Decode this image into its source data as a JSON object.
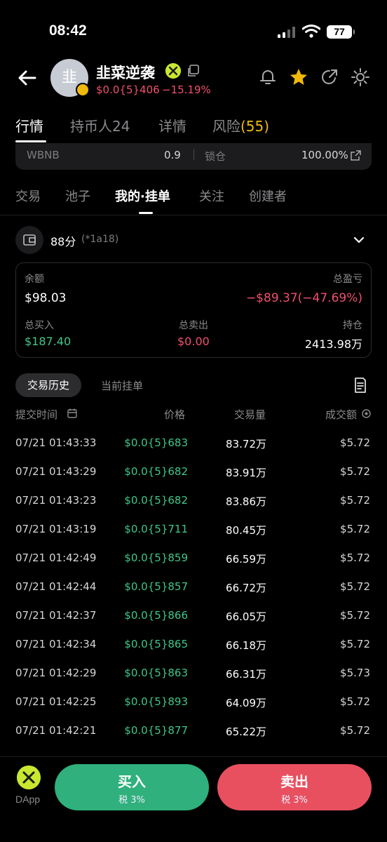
{
  "status_bar": {
    "time": "08:42",
    "battery": "77"
  },
  "header": {
    "avatar_char": "韭",
    "token_name": "韭菜逆袭",
    "price": "$0.0{5}406",
    "change": "−15.19%"
  },
  "main_tabs": [
    "行情",
    "持币人24",
    "详情",
    "风险"
  ],
  "risk_count": "(55)",
  "peek": {
    "label": "WBNB",
    "value": "0.9",
    "lock_label": "锁仓",
    "lock_value": "100.00%"
  },
  "sub_tabs": [
    "交易",
    "池子",
    "我的·挂单",
    "关注",
    "创建者"
  ],
  "wallet": {
    "name": "88分",
    "address": "(*1a18)"
  },
  "stats": {
    "balance_label": "余额",
    "balance": "$98.03",
    "pnl_label": "总盈亏",
    "pnl": "−$89.37(−47.69%)",
    "buy_label": "总买入",
    "buy": "$187.40",
    "sell_label": "总卖出",
    "sell": "$0.00",
    "hold_label": "持仓",
    "hold": "2413.98万"
  },
  "history_tabs": {
    "active": "交易历史",
    "other": "当前挂单"
  },
  "table": {
    "headers": {
      "time": "提交时间",
      "price": "价格",
      "volume": "交易量",
      "amount": "成交额"
    },
    "rows": [
      {
        "time": "07/21 01:43:33",
        "price": "$0.0{5}683",
        "volume": "83.72万",
        "amount": "$5.72"
      },
      {
        "time": "07/21 01:43:29",
        "price": "$0.0{5}682",
        "volume": "83.91万",
        "amount": "$5.72"
      },
      {
        "time": "07/21 01:43:23",
        "price": "$0.0{5}682",
        "volume": "83.86万",
        "amount": "$5.72"
      },
      {
        "time": "07/21 01:43:19",
        "price": "$0.0{5}711",
        "volume": "80.45万",
        "amount": "$5.72"
      },
      {
        "time": "07/21 01:42:49",
        "price": "$0.0{5}859",
        "volume": "66.59万",
        "amount": "$5.72"
      },
      {
        "time": "07/21 01:42:44",
        "price": "$0.0{5}857",
        "volume": "66.72万",
        "amount": "$5.72"
      },
      {
        "time": "07/21 01:42:37",
        "price": "$0.0{5}866",
        "volume": "66.05万",
        "amount": "$5.72"
      },
      {
        "time": "07/21 01:42:34",
        "price": "$0.0{5}865",
        "volume": "66.18万",
        "amount": "$5.72"
      },
      {
        "time": "07/21 01:42:29",
        "price": "$0.0{5}863",
        "volume": "66.31万",
        "amount": "$5.73"
      },
      {
        "time": "07/21 01:42:25",
        "price": "$0.0{5}893",
        "volume": "64.09万",
        "amount": "$5.72"
      },
      {
        "time": "07/21 01:42:21",
        "price": "$0.0{5}877",
        "volume": "65.22万",
        "amount": "$5.72"
      }
    ]
  },
  "bottom": {
    "dapp_label": "DApp",
    "buy_label": "买入",
    "buy_tax": "税 3%",
    "sell_label": "卖出",
    "sell_tax": "税 3%"
  },
  "colors": {
    "up": "#3fc78a",
    "down": "#e8505f",
    "accent": "#f0b90b",
    "brand": "#c8e830"
  },
  "icons": [
    "back-arrow-icon",
    "verified-icon",
    "copy-icon",
    "bell-icon",
    "star-icon",
    "share-icon",
    "settings-icon",
    "external-link-icon",
    "wallet-icon",
    "chevron-down-icon",
    "calendar-icon",
    "doc-list-icon",
    "target-icon",
    "dapp-logo-icon"
  ]
}
